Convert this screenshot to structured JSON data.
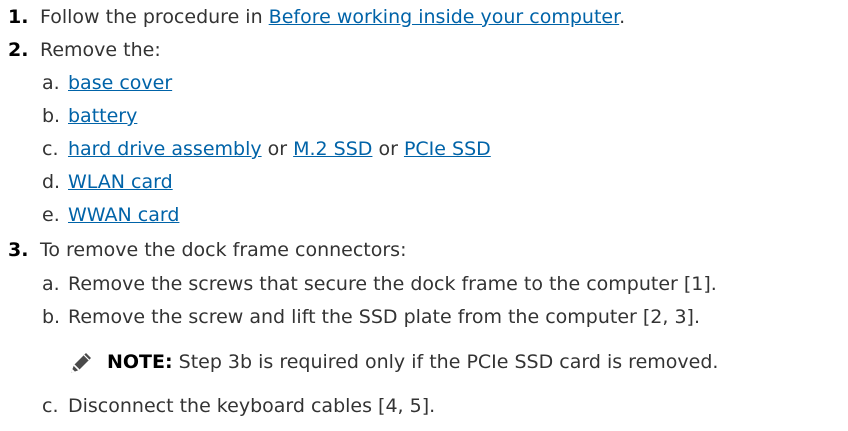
{
  "steps": [
    {
      "number": "1.",
      "text_before": "Follow the procedure in ",
      "link": "Before working inside your computer",
      "text_after": "."
    },
    {
      "number": "2.",
      "text": "Remove the:",
      "subitems": [
        {
          "letter": "a.",
          "link": "base cover"
        },
        {
          "letter": "b.",
          "link": "battery"
        },
        {
          "letter": "c.",
          "link1": "hard drive assembly",
          "sep1": " or ",
          "link2": "M.2 SSD",
          "sep2": " or ",
          "link3": "PCIe SSD"
        },
        {
          "letter": "d.",
          "link": "WLAN card"
        },
        {
          "letter": "e.",
          "link": "WWAN card"
        }
      ]
    },
    {
      "number": "3.",
      "text": "To remove the dock frame connectors:",
      "subitems": [
        {
          "letter": "a.",
          "text": "Remove the screws that secure the dock frame to the computer [1]."
        },
        {
          "letter": "b.",
          "text": "Remove the screw and lift the SSD plate from the computer [2, 3]."
        },
        {
          "letter": "c.",
          "text": "Disconnect the keyboard cables [4, 5]."
        }
      ],
      "note": {
        "icon": "pencil-note-icon",
        "label": "NOTE:",
        "text": " Step 3b is required only if the PCIe SSD card is removed."
      }
    }
  ],
  "colors": {
    "link": "#0063a8",
    "text": "#333333",
    "number": "#000000"
  }
}
